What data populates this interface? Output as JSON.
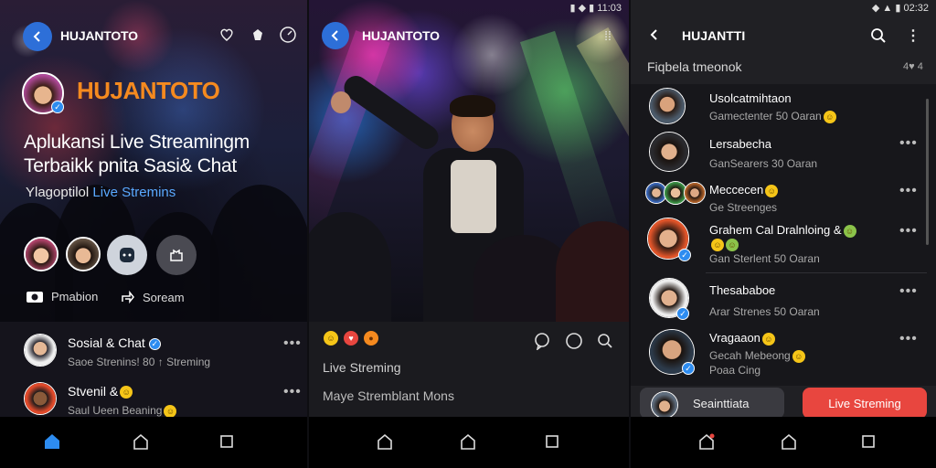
{
  "panel1": {
    "header": {
      "title": "HUJANTOTO"
    },
    "brand": "HUJANTOTO",
    "headline": {
      "line1": "Aplukansi Live Streamingm",
      "line2": "Terbaikk pnita Sasi& Chat"
    },
    "tagline": {
      "white": "Ylagoptilol",
      "blue": "Live Stremins"
    },
    "actions": {
      "left": "Pmabion",
      "right": "Soream"
    },
    "list": [
      {
        "name": "Sosial & Chat",
        "sub": "Saoe Strenins! 80 ↑ Streming"
      },
      {
        "name": "Stvenil &",
        "sub": "Saul Ueen Beaning"
      }
    ]
  },
  "panel2": {
    "status": "11:03",
    "header": {
      "title": "HUJANTOTO"
    },
    "line1": "Live Streming",
    "line2": "Maye Stremblant Mons"
  },
  "panel3": {
    "status": "02:32",
    "header": {
      "title": "HUJANTTI"
    },
    "subtitle": "Fiqbela tmeonok",
    "subtitle_right": "4♥ 4",
    "list": [
      {
        "name": "Usolcatmihtaon",
        "sub": "Gamectenter 50 Oaran"
      },
      {
        "name": "Lersabecha",
        "sub": "GanSearers 30 Oaran"
      },
      {
        "name": "Meccecen",
        "sub": "Ge Streenges"
      },
      {
        "name": "Grahem Cal Dralnloing &",
        "sub2": "Gan Sterlent 50 Oaran"
      },
      {
        "name": "Thesababoe",
        "sub": "Arar Strenes 50 Oaran"
      },
      {
        "name": "Vragaaon",
        "sub": "Gecah Mebeong",
        "sub2": "Poaa Cing"
      }
    ],
    "bottom": {
      "left": "Seainttiata",
      "right": "Live Streming"
    }
  },
  "colors": {
    "accent": "#2d6fd8",
    "brand_orange": "#f58a1f",
    "live_red": "#e8463f",
    "link_blue": "#5aa9ff"
  },
  "icons": [
    "back-icon",
    "heart-icon",
    "gem-icon",
    "timer-icon",
    "dots-icon",
    "search-icon",
    "more-icon",
    "home-icon",
    "square-icon"
  ]
}
